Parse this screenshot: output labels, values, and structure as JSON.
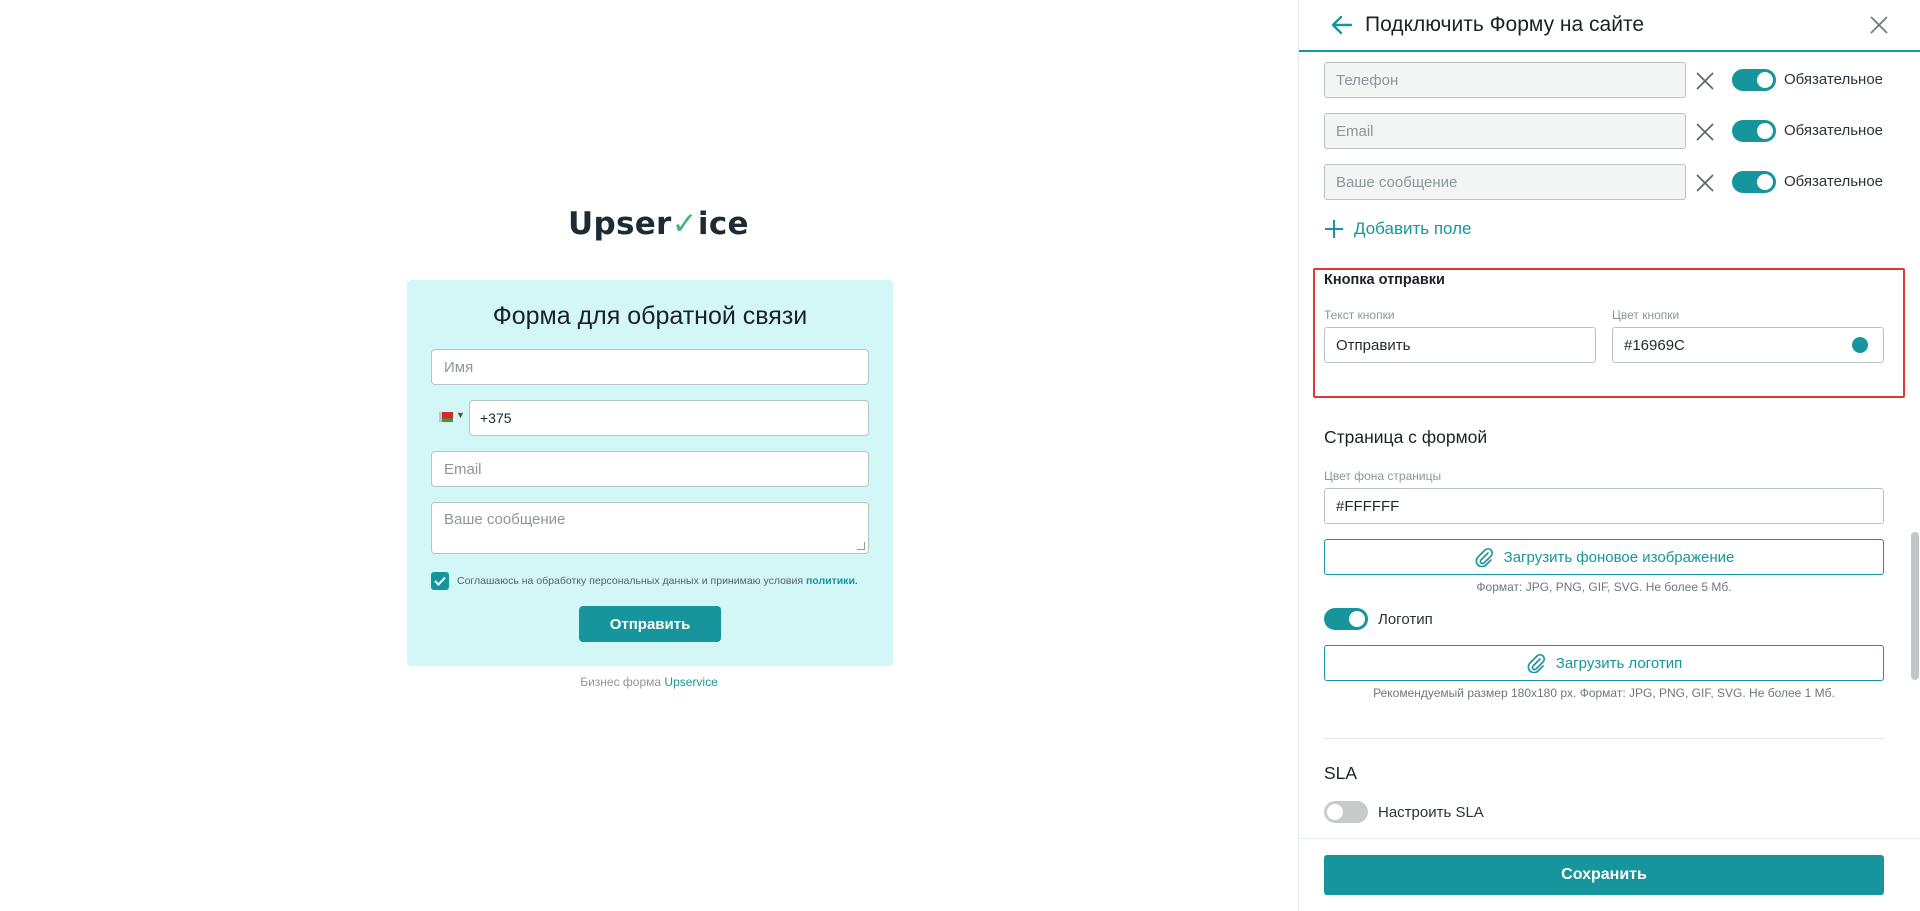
{
  "preview": {
    "logo": {
      "text_before": "Upser",
      "text_tick": "✓",
      "text_after": "ice"
    },
    "form_title": "Форма для обратной связи",
    "name_placeholder": "Имя",
    "phone_value": "+375",
    "email_placeholder": "Email",
    "message_placeholder": "Ваше сообщение",
    "consent_text": "Соглашаюсь на обработку персональных данных и принимаю условия",
    "consent_link": "политики.",
    "submit_label": "Отправить",
    "footer_prefix": "Бизнес форма",
    "footer_brand": "Upservice"
  },
  "panel": {
    "title": "Подключить Форму на сайте",
    "fields": [
      {
        "placeholder": "Телефон",
        "required_label": "Обязательное",
        "required": true
      },
      {
        "placeholder": "Email",
        "required_label": "Обязательное",
        "required": true
      },
      {
        "placeholder": "Ваше сообщение",
        "required_label": "Обязательное",
        "required": true
      }
    ],
    "add_field_label": "Добавить поле",
    "submit_section": {
      "heading": "Кнопка отправки",
      "text_label": "Текст кнопки",
      "text_value": "Отправить",
      "color_label": "Цвет кнопки",
      "color_value": "#16969C"
    },
    "page_section": {
      "heading": "Страница с формой",
      "bg_label": "Цвет фона страницы",
      "bg_value": "#FFFFFF",
      "upload_bg_label": "Загрузить фоновое изображение",
      "upload_bg_hint": "Формат: JPG, PNG, GIF, SVG. Не более 5 Мб.",
      "logo_toggle_label": "Логотип",
      "logo_toggle_on": true,
      "upload_logo_label": "Загрузить логотип",
      "upload_logo_hint": "Рекомендуемый размер 180x180 px. Формат: JPG, PNG, GIF, SVG. Не более 1 Мб."
    },
    "sla_section": {
      "heading": "SLA",
      "toggle_label": "Настроить SLA",
      "toggle_on": false
    },
    "save_label": "Сохранить"
  },
  "colors": {
    "accent": "#16969c",
    "card_bg": "#d3f6f7",
    "highlight_border": "#e0363a"
  }
}
